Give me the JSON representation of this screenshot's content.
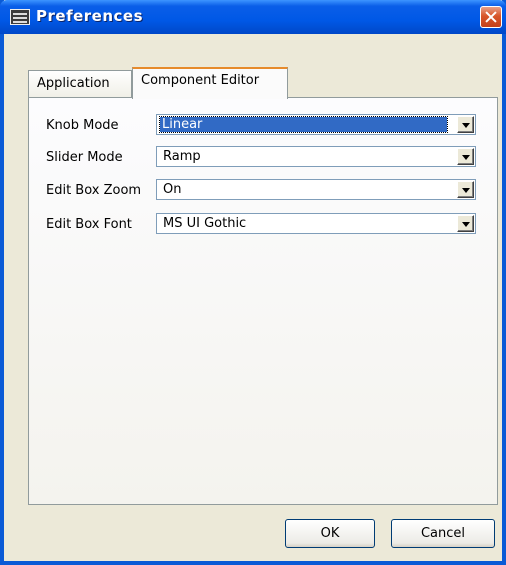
{
  "window": {
    "title": "Preferences"
  },
  "tabs": [
    {
      "label": "Application",
      "selected": false
    },
    {
      "label": "Component Editor",
      "selected": true
    }
  ],
  "fields": [
    {
      "label": "Knob Mode",
      "value": "Linear",
      "focused": true
    },
    {
      "label": "Slider Mode",
      "value": "Ramp",
      "focused": false
    },
    {
      "label": "Edit Box Zoom",
      "value": "On",
      "focused": false
    },
    {
      "label": "Edit Box Font",
      "value": "MS UI Gothic",
      "focused": false
    }
  ],
  "buttons": {
    "ok": "OK",
    "cancel": "Cancel"
  },
  "colors": {
    "titlebar": "#0058e6",
    "selection": "#316ac5",
    "tab_highlight": "#e68b2c",
    "close": "#d8562a"
  }
}
